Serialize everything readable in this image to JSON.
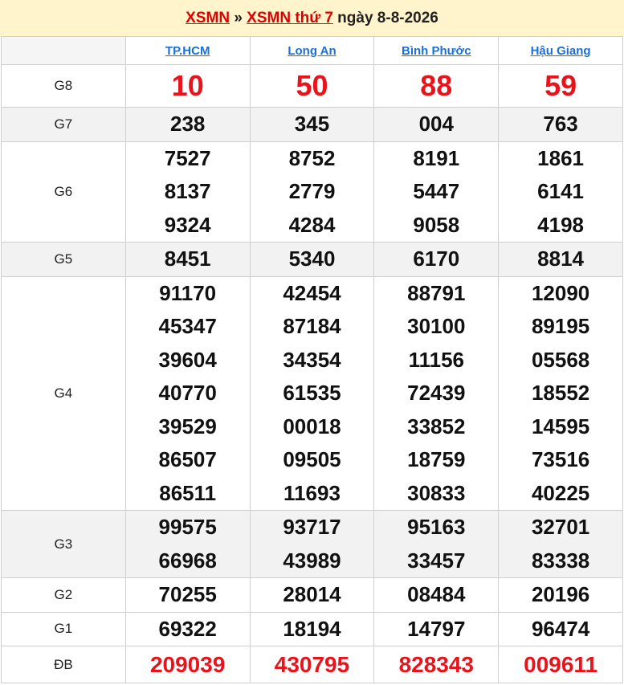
{
  "header": {
    "link1": "XSMN",
    "sep": " » ",
    "link2": "XSMN thứ 7",
    "date_text": " ngày 8-8-2026"
  },
  "provinces": [
    "TP.HCM",
    "Long An",
    "Bình Phước",
    "Hậu Giang"
  ],
  "prizes": [
    {
      "label": "G8",
      "values": [
        [
          "10"
        ],
        [
          "50"
        ],
        [
          "88"
        ],
        [
          "59"
        ]
      ]
    },
    {
      "label": "G7",
      "values": [
        [
          "238"
        ],
        [
          "345"
        ],
        [
          "004"
        ],
        [
          "763"
        ]
      ]
    },
    {
      "label": "G6",
      "values": [
        [
          "7527",
          "8137",
          "9324"
        ],
        [
          "8752",
          "2779",
          "4284"
        ],
        [
          "8191",
          "5447",
          "9058"
        ],
        [
          "1861",
          "6141",
          "4198"
        ]
      ]
    },
    {
      "label": "G5",
      "values": [
        [
          "8451"
        ],
        [
          "5340"
        ],
        [
          "6170"
        ],
        [
          "8814"
        ]
      ]
    },
    {
      "label": "G4",
      "values": [
        [
          "91170",
          "45347",
          "39604",
          "40770",
          "39529",
          "86507",
          "86511"
        ],
        [
          "42454",
          "87184",
          "34354",
          "61535",
          "00018",
          "09505",
          "11693"
        ],
        [
          "88791",
          "30100",
          "11156",
          "72439",
          "33852",
          "18759",
          "30833"
        ],
        [
          "12090",
          "89195",
          "05568",
          "18552",
          "14595",
          "73516",
          "40225"
        ]
      ]
    },
    {
      "label": "G3",
      "values": [
        [
          "99575",
          "66968"
        ],
        [
          "93717",
          "43989"
        ],
        [
          "95163",
          "33457"
        ],
        [
          "32701",
          "83338"
        ]
      ]
    },
    {
      "label": "G2",
      "values": [
        [
          "70255"
        ],
        [
          "28014"
        ],
        [
          "08484"
        ],
        [
          "20196"
        ]
      ]
    },
    {
      "label": "G1",
      "values": [
        [
          "69322"
        ],
        [
          "18194"
        ],
        [
          "14797"
        ],
        [
          "96474"
        ]
      ]
    },
    {
      "label": "ĐB",
      "values": [
        [
          "209039"
        ],
        [
          "430795"
        ],
        [
          "828343"
        ],
        [
          "009611"
        ]
      ]
    }
  ]
}
